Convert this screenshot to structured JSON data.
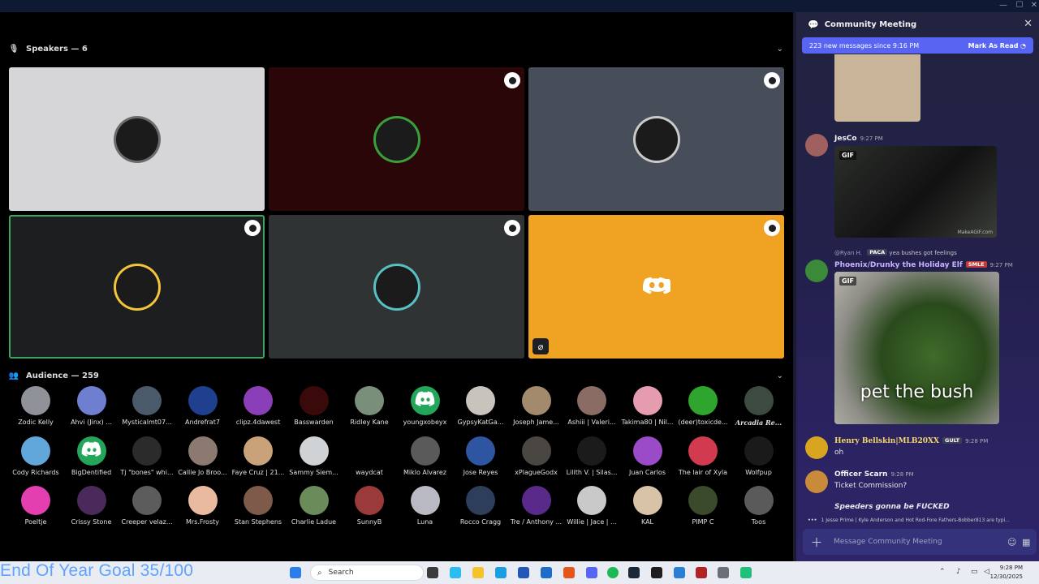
{
  "window": {
    "min_glyph": "—",
    "max_glyph": "☐",
    "close_glyph": "✕"
  },
  "stage": {
    "speakers_header": "Speakers — 6",
    "audience_header": "Audience — 259",
    "speaker_tiles": [
      {
        "bg": "#d6d6d9",
        "ring": "#6b6b6b",
        "badge": false,
        "mute": false,
        "highlight": false,
        "icon": "cartoon-character-icon"
      },
      {
        "bg": "#2a0608",
        "ring": "#3aa03a",
        "badge": true,
        "mute": false,
        "highlight": false,
        "icon": "plant-icon"
      },
      {
        "bg": "#474e59",
        "ring": "#c9c9c9",
        "badge": true,
        "mute": false,
        "highlight": false,
        "icon": "person-sunglasses-icon"
      },
      {
        "bg": "#1d1e20",
        "ring": "#f3c53a",
        "badge": true,
        "mute": false,
        "highlight": true,
        "icon": "anime-character-icon"
      },
      {
        "bg": "#2f3334",
        "ring": "#57c0c3",
        "badge": true,
        "mute": false,
        "highlight": false,
        "icon": "car-icon"
      },
      {
        "bg": "#f0a323",
        "ring": "#f0a323",
        "badge": true,
        "mute": true,
        "highlight": false,
        "icon": "discord-logo-icon"
      }
    ],
    "audience": [
      {
        "name": "Zodic Kelly",
        "color": "#8f9298"
      },
      {
        "name": "Ahvi (Jinx) ...",
        "color": "#6f7fd0"
      },
      {
        "name": "Mysticalmt07...",
        "color": "#4b5a6b"
      },
      {
        "name": "Andrefrat7",
        "color": "#1f3f8f"
      },
      {
        "name": "clipz.4dawest",
        "color": "#8a3fb8"
      },
      {
        "name": "Basswarden",
        "color": "#3a0a0a"
      },
      {
        "name": "Ridley Kane",
        "color": "#7a8f7a"
      },
      {
        "name": "youngxobeyx",
        "color": "#23a55a"
      },
      {
        "name": "GypsyKatGa...",
        "color": "#c9c3bd"
      },
      {
        "name": "Joseph Jame...",
        "color": "#a38a6c"
      },
      {
        "name": "Ashiii | Valeri...",
        "color": "#8b6c64"
      },
      {
        "name": "Takima80 | Nil...",
        "color": "#e49cae"
      },
      {
        "name": "(deer)toxicde...",
        "color": "#2fa52f"
      },
      {
        "name": "Arcadia Re...",
        "color": "#3d4a3f"
      },
      {
        "name": "Cody Richards",
        "color": "#62a7d9"
      },
      {
        "name": "BigDentified",
        "color": "#23a55a"
      },
      {
        "name": "Tj \"bones\" whi...",
        "color": "#2b2b2b"
      },
      {
        "name": "Callie Jo Broo...",
        "color": "#8c7a70"
      },
      {
        "name": "Faye Cruz | 21...",
        "color": "#c9a27a"
      },
      {
        "name": "Sammy Siem...",
        "color": "#d0d3d6"
      },
      {
        "name": "waydcat",
        "color": "#000000"
      },
      {
        "name": "Miklo Alvarez",
        "color": "#5a5a5a"
      },
      {
        "name": "Jose Reyes",
        "color": "#2d55a0"
      },
      {
        "name": "xPlagueGodx",
        "color": "#4a4642"
      },
      {
        "name": "Lilith V. | Silas...",
        "color": "#1b1b1b"
      },
      {
        "name": "Juan Carlos",
        "color": "#9b4bc8"
      },
      {
        "name": "The lair of Xyla",
        "color": "#d23b4f"
      },
      {
        "name": "Wolfpup",
        "color": "#1a1a1a"
      },
      {
        "name": "Poeltje",
        "color": "#e43fb0"
      },
      {
        "name": "Crissy Stone",
        "color": "#4a2a5a"
      },
      {
        "name": "Creeper velaz...",
        "color": "#5c5c5c"
      },
      {
        "name": "Mrs.Frosty",
        "color": "#e9b9a0"
      },
      {
        "name": "Stan Stephens",
        "color": "#7d5a4a"
      },
      {
        "name": "Charlie Ladue",
        "color": "#6a8c5a"
      },
      {
        "name": "SunnyB",
        "color": "#9a3a3a"
      },
      {
        "name": "Luna",
        "color": "#b9b9c4"
      },
      {
        "name": "Rocco Cragg",
        "color": "#2c3e5a"
      },
      {
        "name": "Tre / Anthony ...",
        "color": "#5a2a8a"
      },
      {
        "name": "Willie | Jace | ...",
        "color": "#c9c9c9"
      },
      {
        "name": "KAL",
        "color": "#d8c2a8"
      },
      {
        "name": "PIMP C",
        "color": "#3a4a2a"
      },
      {
        "name": "Toos",
        "color": "#5a5a5a"
      }
    ],
    "goal_text": "End Of Year Goal 35/100"
  },
  "chat": {
    "title": "Community Meeting",
    "close_glyph": "✕",
    "new_messages": "223 new messages since 9:16 PM",
    "mark_read": "Mark As Read",
    "messages": {
      "jesco": {
        "name": "JesCo",
        "time": "9:27 PM",
        "gif_label": "GIF",
        "gif_watermark": "MakeAGIF.com",
        "color": "#f2f3f5"
      },
      "reply": {
        "reply_to": "@Ryan H.",
        "reply_tag": "PACA",
        "reply_text": "yea bushes got feelings"
      },
      "phoenix": {
        "name": "Phoenix/Drunky the Holiday Elf",
        "tag": "SMLE",
        "time": "9:27 PM",
        "gif_label": "GIF",
        "gif_caption": "pet the bush",
        "color": "#c9b3ff"
      },
      "henry": {
        "name": "Henry Bellskin|MLB20XX",
        "tag": "GULT",
        "time": "9:28 PM",
        "text": "oh",
        "color": "#f5d76a"
      },
      "officer": {
        "name": "Officer Scarn",
        "time": "9:28 PM",
        "text": "Ticket Commission?",
        "color": "#f2f3f5"
      },
      "speeders": {
        "text": "Speeders gonna be FUCKED"
      }
    },
    "typing": "1 Jesse Prime | Kyle Anderson and Hot Rod-Fore Fathers-Bobber813 are typi...",
    "composer_placeholder": "Message Community Meeting"
  },
  "taskbar": {
    "search_placeholder": "Search",
    "time": "9:28 PM",
    "date": "12/30/2025"
  }
}
